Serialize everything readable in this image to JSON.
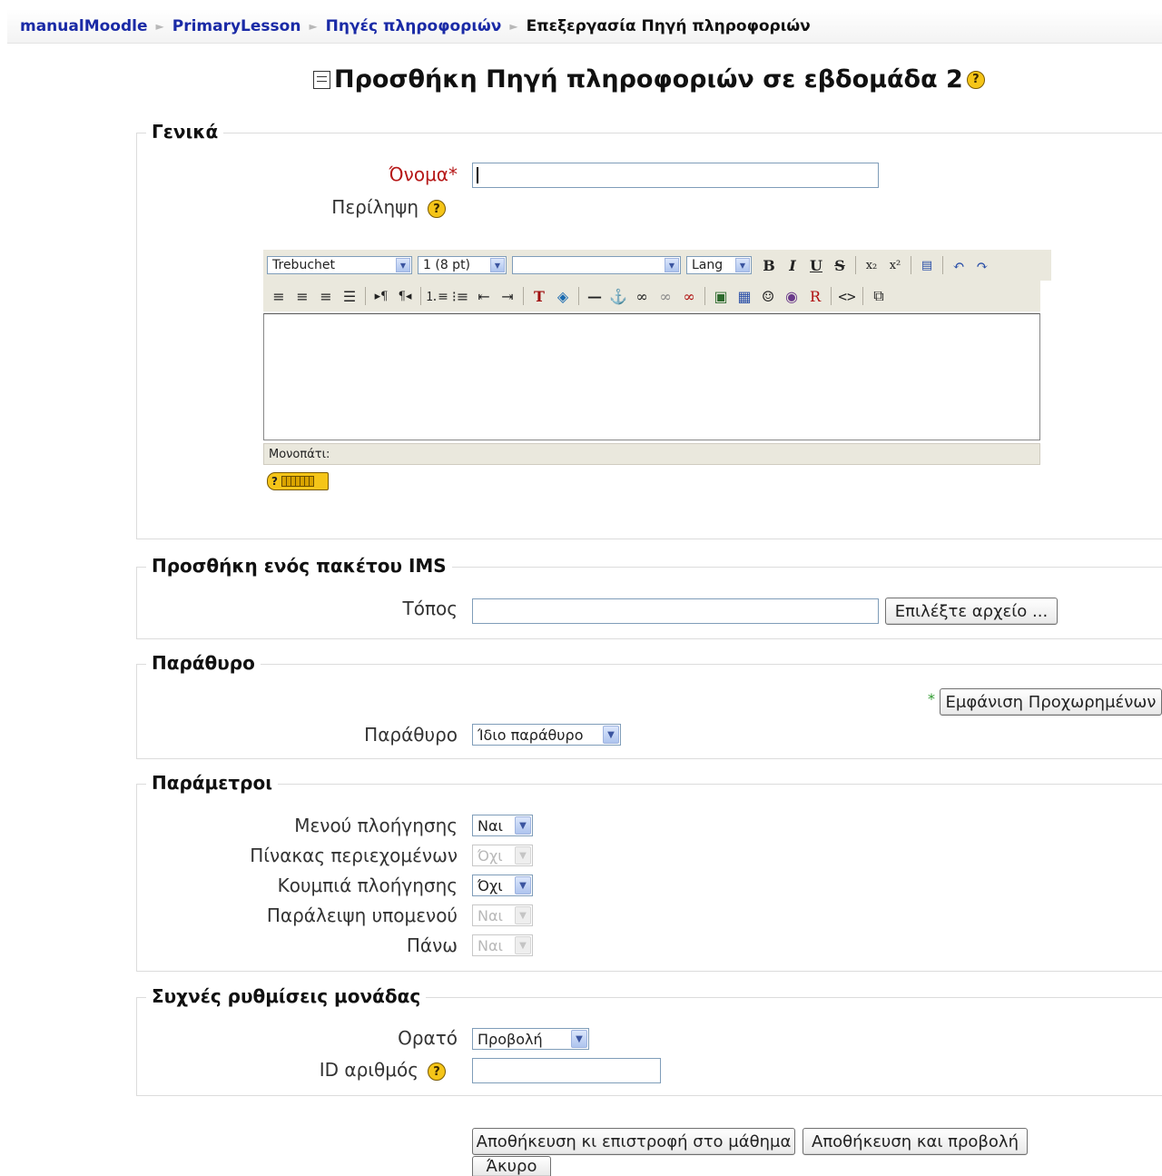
{
  "breadcrumb": {
    "items": [
      "manualMoodle",
      "PrimaryLesson",
      "Πηγές πληροφοριών"
    ],
    "current": "Επεξεργασία Πηγή πληροφοριών",
    "separator": "►"
  },
  "page": {
    "title": "Προσθήκη Πηγή πληροφοριών σε εβδομάδα 2",
    "help_glyph": "?"
  },
  "general": {
    "legend": "Γενικά",
    "name_label": "Όνομα",
    "required_star": "*",
    "name_value": "",
    "summary_label": "Περίληψη",
    "editor": {
      "font": "Trebuchet",
      "size": "1 (8 pt)",
      "format": "",
      "lang": "Lang",
      "path_label": "Μονοπάτι:",
      "icons": [
        "bold-icon",
        "italic-icon",
        "underline-icon",
        "strikethrough-icon",
        "subscript-icon",
        "superscript-icon",
        "paste-word-icon",
        "undo-icon",
        "redo-icon",
        "align-left-icon",
        "align-center-icon",
        "align-right-icon",
        "justify-icon",
        "ltr-icon",
        "rtl-icon",
        "ordered-list-icon",
        "unordered-list-icon",
        "outdent-icon",
        "indent-icon",
        "text-color-icon",
        "background-color-icon",
        "horizontal-rule-icon",
        "anchor-icon",
        "link-icon",
        "unlink-icon",
        "nolink-icon",
        "image-icon",
        "table-icon",
        "smiley-icon",
        "clean-html-icon",
        "search-replace-icon",
        "html-source-icon",
        "fullscreen-icon"
      ]
    }
  },
  "ims": {
    "legend": "Προσθήκη ενός πακέτου IMS",
    "location_label": "Τόπος",
    "location_value": "",
    "choose_button": "Επιλέξτε αρχείο ..."
  },
  "window": {
    "legend": "Παράθυρο",
    "advanced_button": "Εμφάνιση Προχωρημένων",
    "advanced_star": "*",
    "window_label": "Παράθυρο",
    "window_value": "Ίδιο παράθυρο"
  },
  "params": {
    "legend": "Παράμετροι",
    "rows": [
      {
        "label": "Μενού πλοήγησης",
        "value": "Ναι",
        "disabled": false
      },
      {
        "label": "Πίνακας περιεχομένων",
        "value": "Όχι",
        "disabled": true
      },
      {
        "label": "Κουμπιά πλοήγησης",
        "value": "Όχι",
        "disabled": false
      },
      {
        "label": "Παράλειψη υπομενού",
        "value": "Ναι",
        "disabled": true
      },
      {
        "label": "Πάνω",
        "value": "Ναι",
        "disabled": true
      }
    ]
  },
  "common": {
    "legend": "Συχνές ρυθμίσεις μονάδας",
    "visible_label": "Ορατό",
    "visible_value": "Προβολή",
    "id_label": "ID αριθμός",
    "id_value": ""
  },
  "actions": {
    "save_return": "Αποθήκευση κι επιστροφή στο μάθημα",
    "save_display": "Αποθήκευση και προβολή",
    "cancel": "Άκυρο"
  },
  "colors": {
    "link": "#1a2aa6",
    "required": "#b61818",
    "toolbar": "#eae8dd",
    "help_yellow": "#f5c518"
  }
}
